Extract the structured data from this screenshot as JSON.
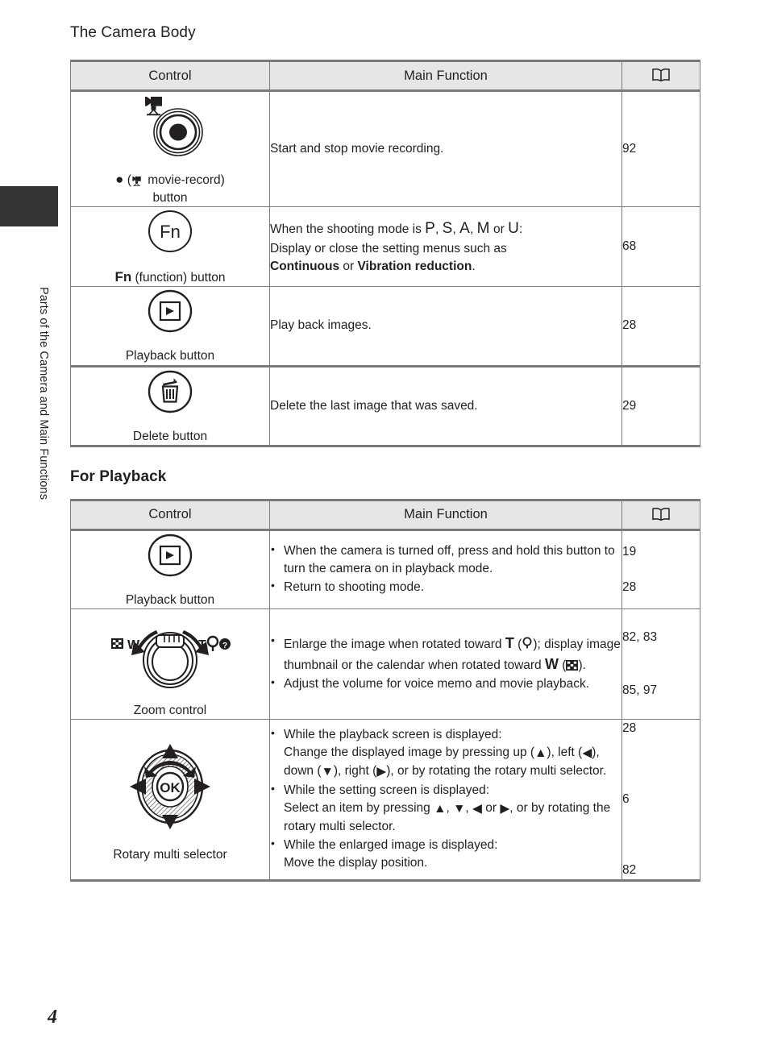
{
  "sidebar": {
    "chapter_label": "Parts of the Camera and Main Functions",
    "tab_color": "#333333"
  },
  "page_title": "The Camera Body",
  "section_heading": "For Playback",
  "page_number": "4",
  "table_headers": {
    "control": "Control",
    "main_function": "Main Function",
    "reference": "book-icon"
  },
  "camera_body_table": {
    "rows": [
      {
        "control_icon": "movie-record-button-icon",
        "control_label_line1": "● ( movie-record)",
        "control_label_line2": "button",
        "function_text": "Start and stop movie recording.",
        "refs": [
          "92"
        ]
      },
      {
        "control_icon": "fn-button-icon",
        "control_icon_text": "Fn",
        "control_label_bold": "Fn",
        "control_label_rest": " (function) button",
        "function_prefix": "When the shooting mode is ",
        "function_modes": [
          "P",
          "S",
          "A",
          "M",
          "U"
        ],
        "function_mode_sep": ", ",
        "function_mode_or": " or ",
        "function_line1_end": ":",
        "function_line2": "Display or close the setting menus such as",
        "function_bold1": "Continuous",
        "function_mid": " or ",
        "function_bold2": "Vibration reduction",
        "function_end": ".",
        "refs": [
          "68"
        ]
      },
      {
        "control_icon": "playback-button-icon",
        "control_label": "Playback button",
        "function_text": "Play back images.",
        "refs": [
          "28"
        ]
      },
      {
        "control_icon": "delete-button-icon",
        "control_label": "Delete button",
        "function_text": "Delete the last image that was saved.",
        "refs": [
          "29"
        ]
      }
    ]
  },
  "playback_table": {
    "rows": [
      {
        "control_icon": "playback-button-icon",
        "control_label": "Playback button",
        "bullets": [
          "When the camera is turned off, press and hold this button to turn the camera on in playback mode.",
          "Return to shooting mode."
        ],
        "refs": [
          "19",
          "28"
        ]
      },
      {
        "control_icon": "zoom-control-icon",
        "control_label": "Zoom control",
        "bullet1_part1": "Enlarge the image when rotated toward ",
        "bullet1_T": "T",
        "bullet1_part2": " (",
        "bullet1_mag": "magnifier-icon",
        "bullet1_part3": "); display image thumbnail or the calendar when rotated toward ",
        "bullet1_W": "W",
        "bullet1_part4": " (",
        "bullet1_thumb": "thumbnail-icon",
        "bullet1_part5": ").",
        "bullet2": "Adjust the volume for voice memo and movie playback.",
        "refs": [
          "82, 83",
          "85, 97"
        ]
      },
      {
        "control_icon": "rotary-multi-selector-icon",
        "control_label": "Rotary multi selector",
        "bullets": [
          {
            "line1": "While the playback screen is displayed:",
            "line2_part1": "Change the displayed image by pressing up (",
            "line2_up": "▲",
            "line2_part2": "), left (",
            "line2_left": "◀",
            "line2_part3": "), down (",
            "line2_down": "▼",
            "line2_part4": "), right (",
            "line2_right": "▶",
            "line2_part5": "), or by rotating the rotary multi selector."
          },
          {
            "line1": "While the setting screen is displayed:",
            "line2_part1": "Select an item by pressing ",
            "line2_up": "▲",
            "line2_part2": ", ",
            "line2_down": "▼",
            "line2_part3": ", ",
            "line2_left": "◀",
            "line2_part4": " or ",
            "line2_right": "▶",
            "line2_part5": ", or by rotating the rotary multi selector."
          },
          {
            "line1": "While the enlarged image is displayed:",
            "line2_part1": "Move the display position."
          }
        ],
        "refs": [
          "28",
          "6",
          "82"
        ]
      }
    ]
  }
}
